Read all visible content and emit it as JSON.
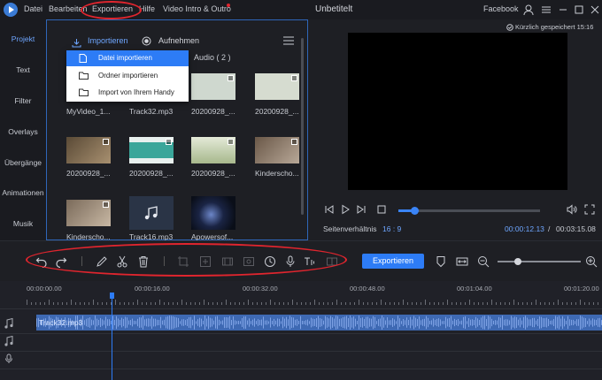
{
  "titlebar": {
    "menu": [
      "Datei",
      "Bearbeiten",
      "Exportieren",
      "Hilfe",
      "Video Intro & Outro"
    ],
    "title": "Unbetitelt",
    "facebook": "Facebook",
    "icons": [
      "app-logo-icon",
      "user-icon",
      "menu-icon",
      "minimize-icon",
      "maximize-icon",
      "close-icon"
    ]
  },
  "left_tabs": [
    "Projekt",
    "Text",
    "Filter",
    "Overlays",
    "Übergänge",
    "Animationen",
    "Musik"
  ],
  "media": {
    "import_label": "Importieren",
    "record_label": "Aufnehmen",
    "audio_tab": "Audio ( 2 )",
    "dropdown": [
      "Datei importieren",
      "Ordner importieren",
      "Import von Ihrem Handy"
    ],
    "items": [
      {
        "caption": "MyVideo_1...",
        "kind": "hidden"
      },
      {
        "caption": "Track32.mp3",
        "kind": "hidden"
      },
      {
        "caption": "20200928_...",
        "kind": "image",
        "color": "#cfd8cf"
      },
      {
        "caption": "20200928_...",
        "kind": "image",
        "color": "#d6dcd0"
      },
      {
        "caption": "20200928_...",
        "kind": "image",
        "color": "#7a6a50"
      },
      {
        "caption": "20200928_...",
        "kind": "image",
        "color": "#3aa69a"
      },
      {
        "caption": "20200928_...",
        "kind": "image",
        "color": "#b9c7a8"
      },
      {
        "caption": "Kinderscho...",
        "kind": "image",
        "color": "#8c7a6a"
      },
      {
        "caption": "Kinderscho...",
        "kind": "image",
        "color": "#9a8c7c"
      },
      {
        "caption": "Track16.mp3",
        "kind": "audio",
        "color": "#2a3446"
      },
      {
        "caption": "Apowersof...",
        "kind": "video",
        "color": "#0d1220"
      }
    ]
  },
  "preview": {
    "saved_label": "Kürzlich gespeichert 15:16",
    "ratio_label": "Seitenverhältnis",
    "ratio_value": "16 : 9",
    "current_time": "00:00:12.13",
    "separator": "/",
    "total_time": "00:03:15.08",
    "progress": 0.11
  },
  "toolbar": {
    "export_label": "Exportieren",
    "zoom_level": 0.24
  },
  "timeline": {
    "ruler": [
      "00:00:00.00",
      "00:00:16.00",
      "00:00:32.00",
      "00:00:48.00",
      "00:01:04.00",
      "00:01:20.00"
    ],
    "audio_clip": "Track32.mp3"
  },
  "colors": {
    "accent": "#2d7cf6",
    "annotation": "#e0252e",
    "background": "#1e1f24"
  }
}
